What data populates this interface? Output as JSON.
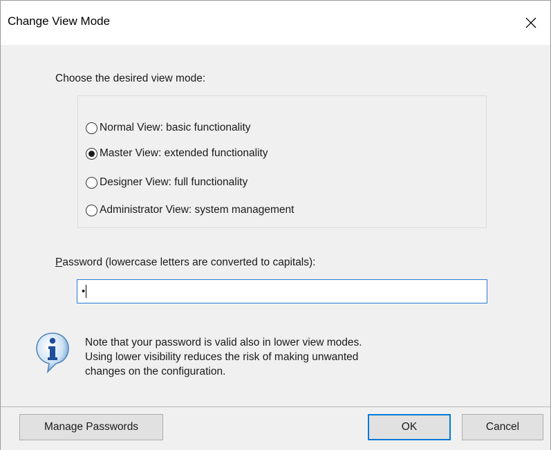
{
  "window": {
    "title": "Change View Mode"
  },
  "prompt": "Choose the desired view mode:",
  "modes": [
    {
      "label": "Normal View:  basic functionality",
      "selected": false
    },
    {
      "label": "Master View:  extended functionality",
      "selected": true
    },
    {
      "label": "Designer View:  full functionality",
      "selected": false
    },
    {
      "label": "Administrator View:  system management",
      "selected": false
    }
  ],
  "password": {
    "label_accel": "P",
    "label_rest": "assword (lowercase letters are converted to capitals):",
    "value": "•"
  },
  "note": {
    "lines": [
      "Note that your password is valid also in lower view modes.",
      "Using lower visibility reduces the risk of making unwanted",
      "changes on the configuration."
    ]
  },
  "buttons": {
    "manage": "Manage Passwords",
    "ok": "OK",
    "cancel": "Cancel"
  },
  "colors": {
    "focus_border": "#0078d7",
    "dialog_bg": "#f0f0f0"
  }
}
